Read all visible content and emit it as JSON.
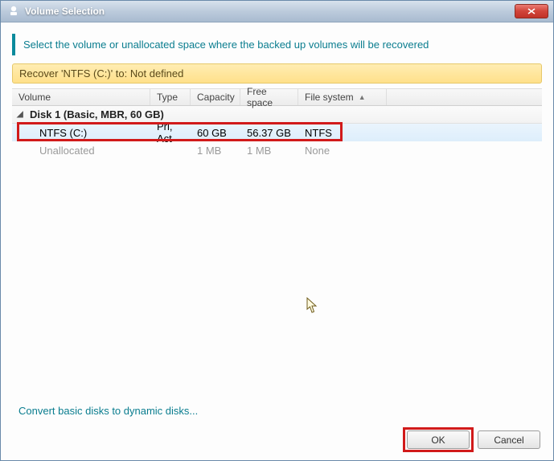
{
  "window": {
    "title": "Volume Selection"
  },
  "instruction": "Select the volume or unallocated space where the backed up volumes will be recovered",
  "recover_bar": "Recover 'NTFS (C:)' to:  Not defined",
  "columns": {
    "volume": "Volume",
    "type": "Type",
    "capacity": "Capacity",
    "freespace": "Free space",
    "filesystem": "File system"
  },
  "disk": {
    "label": "Disk 1 (Basic, MBR, 60 GB)"
  },
  "rows": [
    {
      "volume": "NTFS (C:)",
      "type": "Pri, Act",
      "capacity": "60 GB",
      "freespace": "56.37 GB",
      "filesystem": "NTFS",
      "selected": true
    },
    {
      "volume": "Unallocated",
      "type": "",
      "capacity": "1 MB",
      "freespace": "1 MB",
      "filesystem": "None",
      "selected": false
    }
  ],
  "link": "Convert basic disks to dynamic disks...",
  "buttons": {
    "ok": "OK",
    "cancel": "Cancel"
  }
}
